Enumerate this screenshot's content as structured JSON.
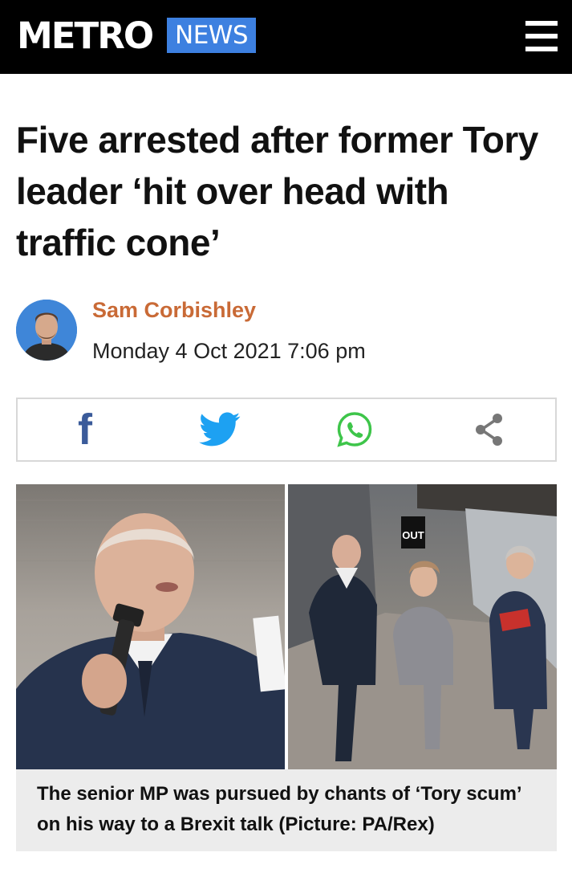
{
  "header": {
    "logo": "METRO",
    "section": "NEWS",
    "menu_icon": "hamburger-menu-icon",
    "accent_color": "#3d80e0"
  },
  "article": {
    "headline": "Five arrested after former Tory leader ‘hit over head with traffic cone’",
    "author": "Sam Corbishley",
    "author_color": "#c96a36",
    "date": "Monday 4 Oct 2021 7:06 pm"
  },
  "share": {
    "buttons": [
      {
        "name": "facebook",
        "icon": "facebook-icon",
        "color": "#3b5b9a"
      },
      {
        "name": "twitter",
        "icon": "twitter-bird-icon",
        "color": "#1da1f2"
      },
      {
        "name": "whatsapp",
        "icon": "whatsapp-icon",
        "color": "#3ec54a"
      },
      {
        "name": "share",
        "icon": "share-icon",
        "color": "#777777"
      }
    ]
  },
  "image": {
    "caption": "The senior MP was pursued by chants of ‘Tory scum’ on his way to a Brexit talk (Picture: PA/Rex)",
    "sign_text": "OUT"
  }
}
